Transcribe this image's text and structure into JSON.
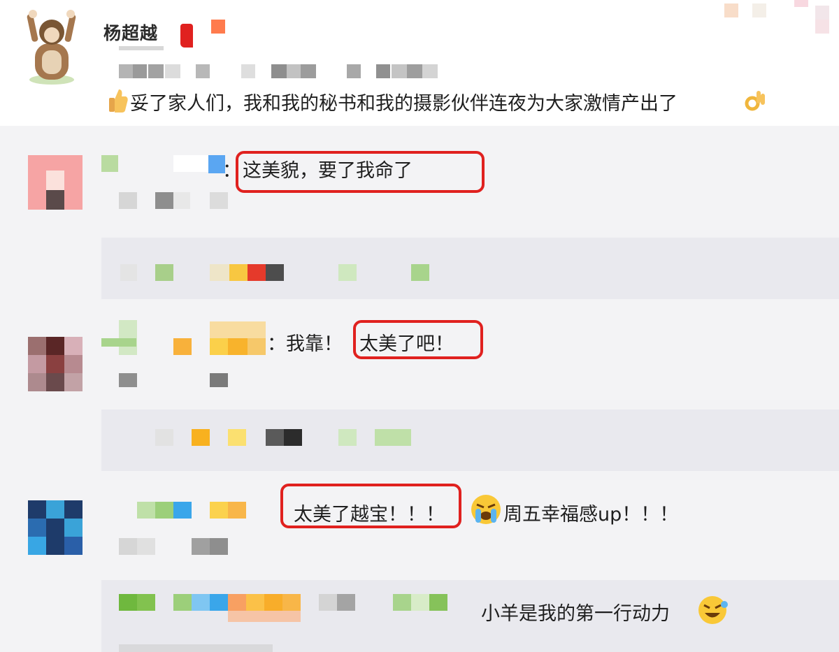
{
  "post": {
    "author_name": "杨超越",
    "text": "妥了家人们，我和我的秘书和我的摄影伙伴连夜为大家激情产出了",
    "leading_icon": "thumbs-up-icon",
    "trailing_icon": "ok-hand-icon"
  },
  "comments": [
    {
      "body": "这美貌，要了我命了",
      "highlight_color": "#e0211f"
    },
    {
      "prefix": "：我靠！",
      "highlight": "太美了吧！",
      "highlight_color": "#e0211f"
    },
    {
      "highlight": "太美了越宝！！！",
      "suffix": "周五幸福感up！！！",
      "emoji": "crying-face-icon",
      "highlight_color": "#e0211f"
    }
  ],
  "reply": {
    "text": "小羊是我的第一行动力",
    "emoji": "laughing-crying-face-icon"
  },
  "colors": {
    "highlight": "#e0211f",
    "panel": "#e9e9ee",
    "background": "#f3f3f5"
  }
}
